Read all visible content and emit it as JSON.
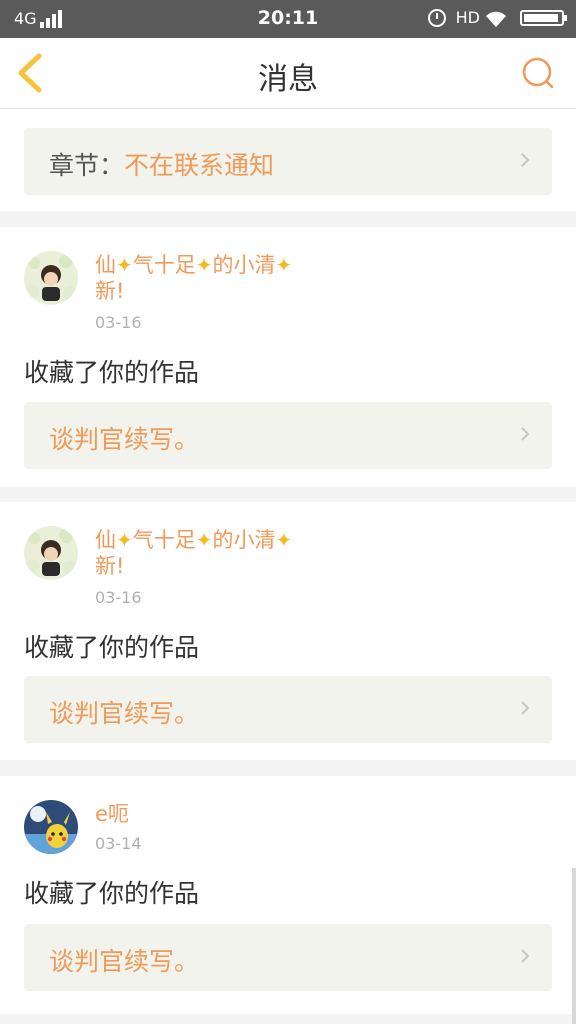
{
  "status_bar": {
    "network": "4G",
    "time": "20:11",
    "hd": "HD",
    "battery_level": 0.95
  },
  "nav": {
    "title": "消息",
    "back_icon": "chevron-left-icon",
    "search_icon": "search-icon"
  },
  "partial_card": {
    "chapter_label": "章节：",
    "chapter_value": "不在联系通知"
  },
  "notifications": [
    {
      "user_parts": [
        "仙",
        "✦",
        "气十足",
        "✦",
        "的小清",
        "✦",
        "新!"
      ],
      "date": "03-16",
      "action": "收藏了你的作品",
      "work": "谈判官续写。"
    },
    {
      "user_parts": [
        "仙",
        "✦",
        "气十足",
        "✦",
        "的小清",
        "✦",
        "新!"
      ],
      "date": "03-16",
      "action": "收藏了你的作品",
      "work": "谈判官续写。"
    },
    {
      "user_parts": [
        "e呃"
      ],
      "date": "03-14",
      "action": "收藏了你的作品",
      "work": "谈判官续写。"
    }
  ],
  "colors": {
    "accent": "#f09a59",
    "sparkle": "#f5b820",
    "work_box_bg": "#f2f3ec",
    "status_bar_bg": "#5a5a5a"
  }
}
